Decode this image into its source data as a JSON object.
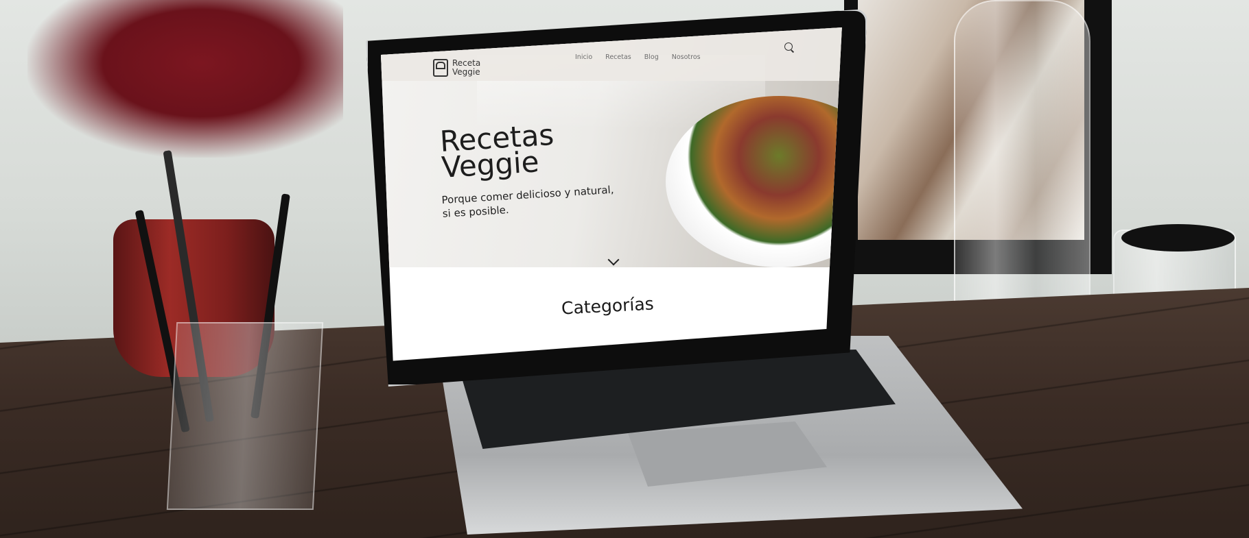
{
  "site": {
    "logo": {
      "icon": "chef-hat-icon",
      "line1": "Receta",
      "line2": "Veggie"
    },
    "nav": {
      "links": [
        "Inicio",
        "Recetas",
        "Blog",
        "Nosotros"
      ],
      "search_icon": "search-icon"
    },
    "hero": {
      "title_line1": "Recetas",
      "title_line2": "Veggie",
      "subtitle_line1": "Porque comer delicioso y natural,",
      "subtitle_line2": "si es posible.",
      "scroll_icon": "chevron-down-icon"
    },
    "sections": {
      "categories_title": "Categorías"
    }
  },
  "colors": {
    "text_dark": "#1d1d1d",
    "nav_link": "#6d6d6d",
    "desk_wood": "#3b2c25",
    "plant_red": "#7c1620"
  }
}
